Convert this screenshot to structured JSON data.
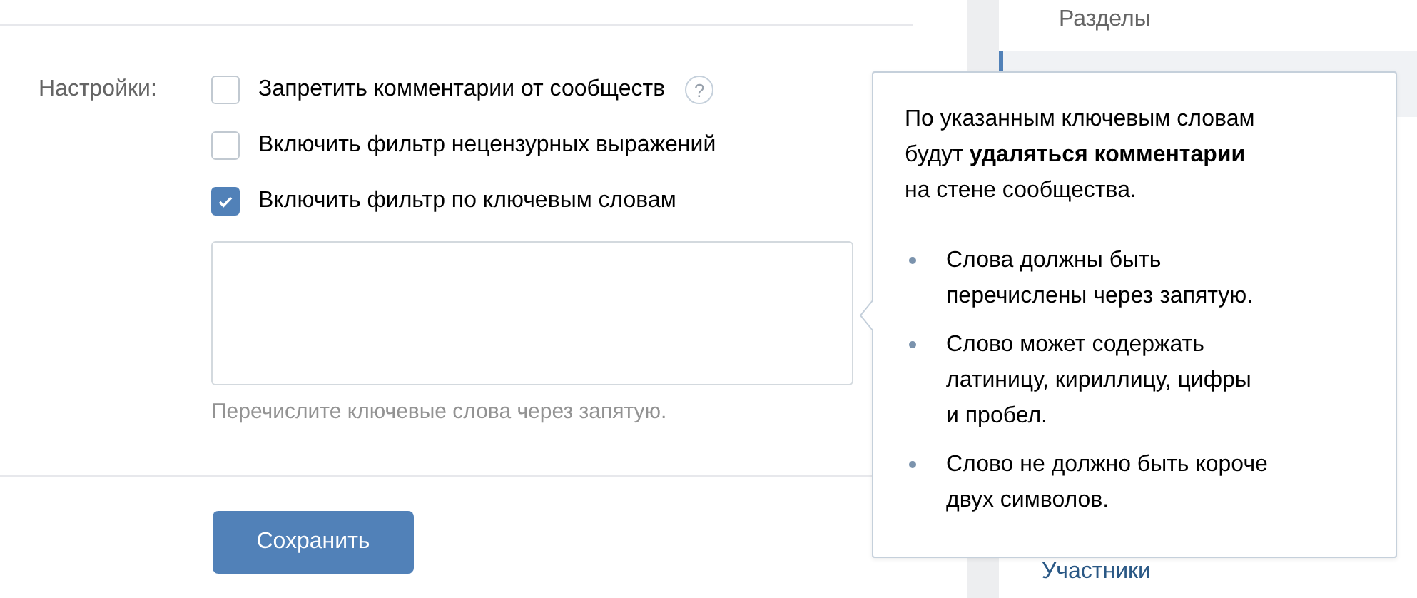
{
  "settings": {
    "label": "Настройки:",
    "options": [
      {
        "label": "Запретить комментарии от сообществ",
        "checked": false,
        "help": "?"
      },
      {
        "label": "Включить фильтр нецензурных выражений",
        "checked": false
      },
      {
        "label": "Включить фильтр по ключевым словам",
        "checked": true
      }
    ],
    "keywords_hint": "Перечислите ключевые слова через запятую."
  },
  "save_button": "Сохранить",
  "sidebar": {
    "items": [
      {
        "label": "Разделы",
        "selected": false
      },
      {
        "selected": true
      },
      {
        "label": "Участники",
        "selected": false
      }
    ]
  },
  "tooltip": {
    "intro": "По указанным ключевым словам\nбудут **удаляться комментарии**\nна стене сообщества.",
    "bullets": [
      "Слова должны быть\nперечислены через запятую.",
      "Слово может содержать\nлатиницу, кириллицу, цифры\nи пробел.",
      "Слово не должно быть короче\nдвух символов."
    ]
  }
}
